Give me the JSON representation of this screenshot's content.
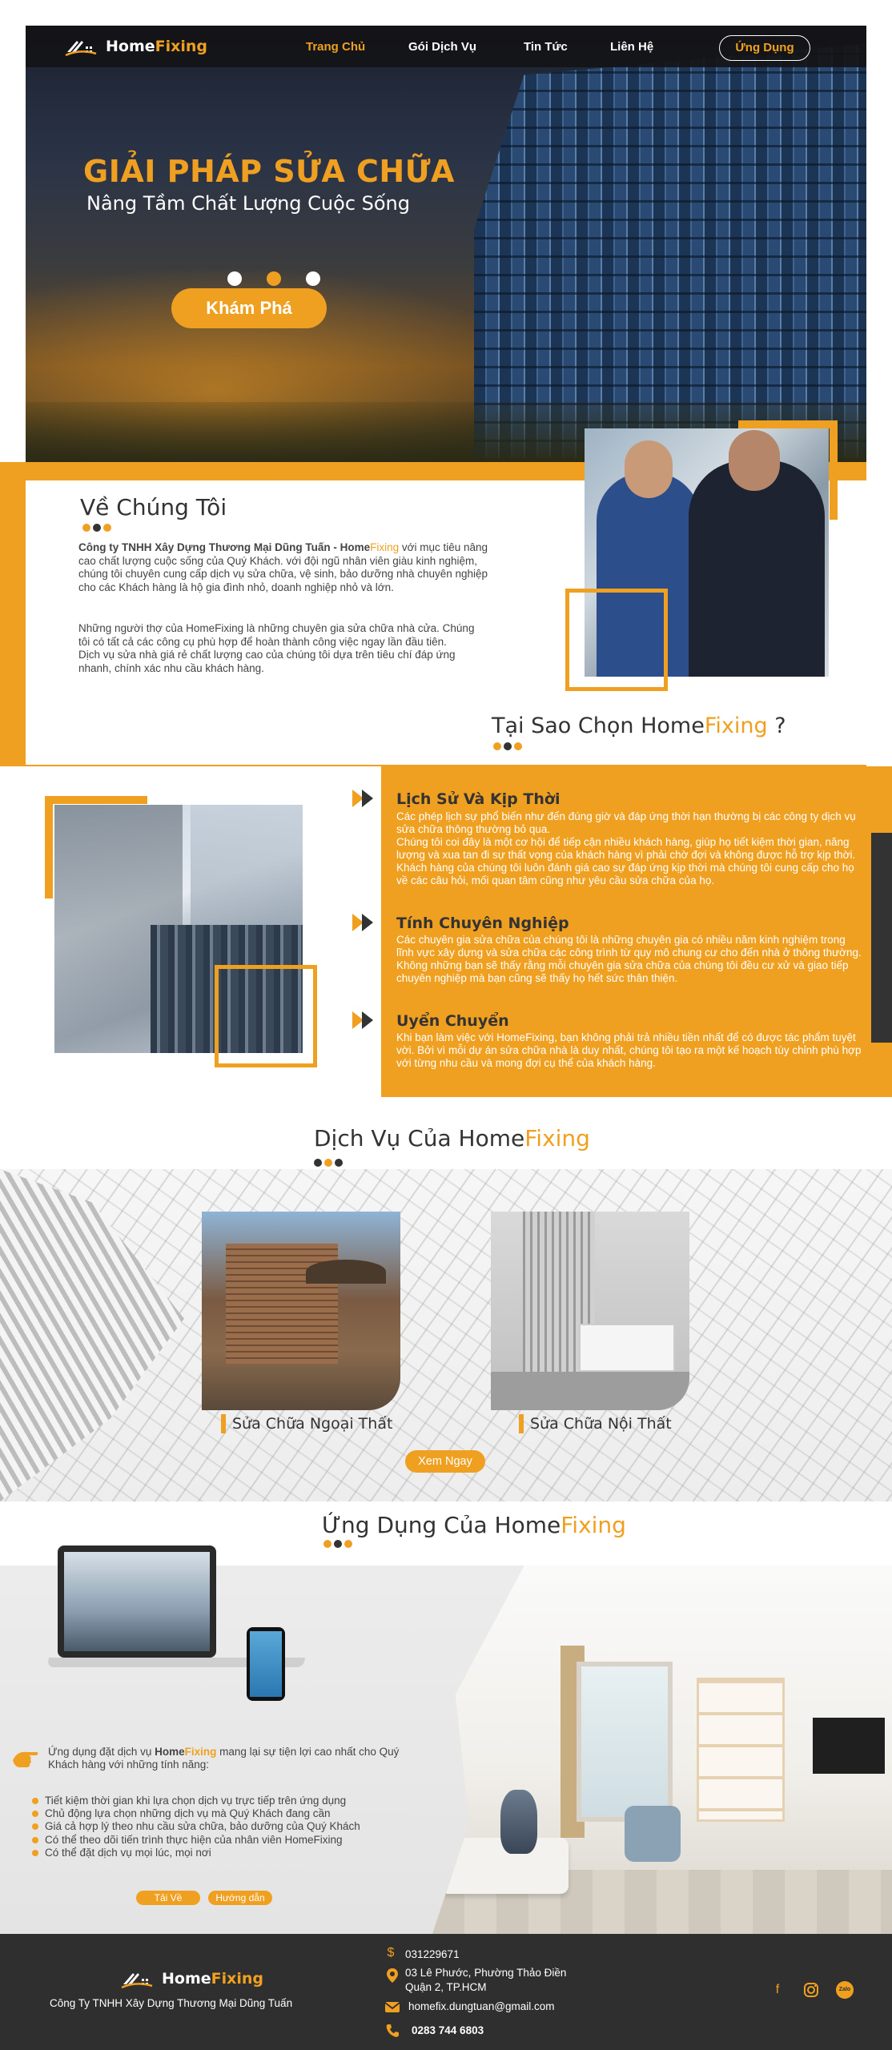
{
  "colors": {
    "accent": "#f0a020",
    "dark": "#2f2f2f",
    "text": "#3a3a3a",
    "white": "#ffffff"
  },
  "brand": {
    "part1": "Home",
    "part2": "Fixing"
  },
  "nav": {
    "items": [
      "Trang Chủ",
      "Gói Dịch Vụ",
      "Tin Tức",
      "Liên Hệ"
    ],
    "active_index": 0,
    "app_button": "Ứng Dụng"
  },
  "hero": {
    "title": "GIẢI PHÁP SỬA CHỮA",
    "subtitle": "Nâng Tầm Chất Lượng Cuộc Sống",
    "slide_count": 3,
    "active_slide": 1,
    "cta": "Khám Phá"
  },
  "about": {
    "title": "Về Chúng Tôi",
    "p1_strong": "Công ty TNHH Xây Dựng Thương Mại Dũng Tuấn - Home",
    "p1_brand2": "Fixing",
    "p1_rest": " với mục tiêu nâng cao chất lượng cuộc sống của Quý Khách. với đội ngũ nhân viên giàu kinh nghiệm, chúng tôi chuyên cung cấp dịch vụ sửa chữa, vệ sinh, bảo dưỡng nhà chuyên nghiệp cho các Khách hàng là hộ gia đình nhỏ, doanh nghiệp nhỏ và lớn.",
    "p2": "Những người thợ của HomeFixing là những chuyên gia sửa chữa nhà cửa. Chúng tôi có tất cả các công cụ phù hợp để hoàn thành công việc ngay lần đầu tiên.",
    "p3": "Dịch vụ sửa nhà giá rẻ chất lượng cao của chúng tôi dựa trên tiêu chí đáp ứng nhanh, chính xác nhu cầu khách hàng."
  },
  "why": {
    "title_part1": "Tại Sao Chọn Home",
    "title_part2": "Fixing",
    "title_part3": " ?",
    "items": [
      {
        "heading": "Lịch Sử Và Kịp Thời",
        "text": "Các phép lịch sự phổ biến như đến đúng giờ và đáp ứng thời hạn thường bị các công ty dịch vụ sửa chữa thông thường bỏ qua.\nChúng tôi coi đây là một cơ hội để tiếp cận nhiều khách hàng, giúp họ tiết kiệm thời gian, năng lượng và xua tan đi sự thất vọng của khách hàng vì phải chờ đợi và không được hỗ trợ kịp thời.\nKhách hàng của chúng tôi luôn đánh giá cao sự đáp ứng kịp thời mà chúng tôi cung cấp cho họ về các câu hỏi, mối quan tâm cũng như yêu cầu sửa chữa của họ."
      },
      {
        "heading": "Tính Chuyên Nghiệp",
        "text": "Các chuyên gia sửa chữa của chúng tôi là những chuyên gia có nhiều năm kinh nghiệm trong lĩnh vực xây dựng và sửa chữa các công trình từ quy mô chung cư cho đến nhà ở thông thường. Không những bạn sẽ thấy rằng mỗi chuyên gia sửa chữa của chúng tôi đều cư xử và giao tiếp chuyên nghiệp mà bạn cũng sẽ thấy họ hết sức thân thiện."
      },
      {
        "heading": "Uyển Chuyển",
        "text": "Khi bạn làm việc với HomeFixing, bạn không phải trả nhiều tiền nhất để có được tác phẩm tuyệt vời. Bởi vì mỗi dự án sửa chữa nhà là duy nhất, chúng tôi tạo ra một kế hoạch tùy chỉnh phù hợp với từng nhu cầu và mong đợi cụ thể của khách hàng."
      }
    ]
  },
  "services": {
    "title_part1": "Dịch Vụ Của Home",
    "title_part2": "Fixing",
    "items": [
      {
        "label": "Sửa Chữa Ngoại Thất"
      },
      {
        "label": "Sửa Chữa Nội Thất"
      }
    ],
    "cta": "Xem Ngay"
  },
  "app": {
    "title_part1": "Ứng Dụng Của Home",
    "title_part2": "Fixing",
    "intro_a": "Ứng dụng đặt dịch vụ ",
    "intro_brand1": "Home",
    "intro_brand2": "Fixing",
    "intro_b": " mang lại sự tiện lợi cao nhất cho Quý Khách hàng với những tính năng:",
    "features": [
      "Tiết kiệm thời gian khi lựa chọn dịch vụ trực tiếp trên ứng dụng",
      "Chủ động lựa chọn những dịch vụ mà Quý Khách đang cần",
      "Giá cả hợp lý theo nhu cầu sửa chữa, bảo dưỡng của Quý Khách",
      "Có thể theo dõi tiến trình thực hiện của nhân viên HomeFixing",
      "Có thể đặt dịch vụ mọi lúc, mọi nơi"
    ],
    "download_btn": "Tải Về",
    "guide_btn": "Hướng dẫn"
  },
  "footer": {
    "company": "Công Ty TNHH Xây Dựng Thương Mại Dũng Tuấn",
    "tax": "031229671",
    "address_line1": "03 Lê Phước, Phường Thảo Điền",
    "address_line2": "Quận 2, TP.HCM",
    "email": "homefix.dungtuan@gmail.com",
    "phone": "0283 744 6803",
    "icons": [
      "dollar-icon",
      "location-pin-icon",
      "mail-icon",
      "phone-icon",
      "facebook-icon",
      "instagram-icon",
      "zalo-icon"
    ],
    "zalo_label": "Zalo"
  }
}
